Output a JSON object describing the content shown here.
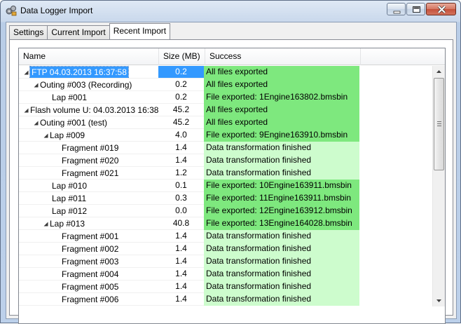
{
  "window": {
    "title": "Data Logger Import"
  },
  "tabs": [
    {
      "label": "Settings",
      "active": false
    },
    {
      "label": "Current Import",
      "active": false
    },
    {
      "label": "Recent Import",
      "active": true
    }
  ],
  "grid": {
    "columns": {
      "name": "Name",
      "size": "Size (MB)",
      "success": "Success"
    },
    "rows": [
      {
        "level": 0,
        "expanded": true,
        "name": "FTP 04.03.2013 16:37:58",
        "size": "0.2",
        "success": "All files exported",
        "status": "ok",
        "selected": true
      },
      {
        "level": 1,
        "expanded": true,
        "name": "Outing #003 (Recording)",
        "size": "0.2",
        "success": "All files exported",
        "status": "ok"
      },
      {
        "level": 2,
        "expanded": null,
        "name": "Lap #001",
        "size": "0.2",
        "success": "File exported:  1Engine163802.bmsbin",
        "status": "ok"
      },
      {
        "level": 0,
        "expanded": true,
        "name": "Flash volume U: 04.03.2013 16:38...",
        "size": "45.2",
        "success": "All files exported",
        "status": "ok"
      },
      {
        "level": 1,
        "expanded": true,
        "name": "Outing #001 (test)",
        "size": "45.2",
        "success": "All files exported",
        "status": "ok"
      },
      {
        "level": 2,
        "expanded": true,
        "name": "Lap #009",
        "size": "4.0",
        "success": "File exported:  9Engine163910.bmsbin",
        "status": "ok"
      },
      {
        "level": 3,
        "expanded": null,
        "name": "Fragment #019",
        "size": "1.4",
        "success": "Data transformation finished",
        "status": "info"
      },
      {
        "level": 3,
        "expanded": null,
        "name": "Fragment #020",
        "size": "1.4",
        "success": "Data transformation finished",
        "status": "info"
      },
      {
        "level": 3,
        "expanded": null,
        "name": "Fragment #021",
        "size": "1.2",
        "success": "Data transformation finished",
        "status": "info"
      },
      {
        "level": 2,
        "expanded": null,
        "name": "Lap #010",
        "size": "0.1",
        "success": "File exported:  10Engine163911.bmsbin",
        "status": "ok"
      },
      {
        "level": 2,
        "expanded": null,
        "name": "Lap #011",
        "size": "0.3",
        "success": "File exported:  11Engine163911.bmsbin",
        "status": "ok"
      },
      {
        "level": 2,
        "expanded": null,
        "name": "Lap #012",
        "size": "0.0",
        "success": "File exported:  12Engine163912.bmsbin",
        "status": "ok"
      },
      {
        "level": 2,
        "expanded": true,
        "name": "Lap #013",
        "size": "40.8",
        "success": "File exported:  13Engine164028.bmsbin",
        "status": "ok"
      },
      {
        "level": 3,
        "expanded": null,
        "name": "Fragment #001",
        "size": "1.4",
        "success": "Data transformation finished",
        "status": "info"
      },
      {
        "level": 3,
        "expanded": null,
        "name": "Fragment #002",
        "size": "1.4",
        "success": "Data transformation finished",
        "status": "info"
      },
      {
        "level": 3,
        "expanded": null,
        "name": "Fragment #003",
        "size": "1.4",
        "success": "Data transformation finished",
        "status": "info"
      },
      {
        "level": 3,
        "expanded": null,
        "name": "Fragment #004",
        "size": "1.4",
        "success": "Data transformation finished",
        "status": "info"
      },
      {
        "level": 3,
        "expanded": null,
        "name": "Fragment #005",
        "size": "1.4",
        "success": "Data transformation finished",
        "status": "info"
      },
      {
        "level": 3,
        "expanded": null,
        "name": "Fragment #006",
        "size": "1.4",
        "success": "Data transformation finished",
        "status": "info"
      }
    ]
  },
  "colors": {
    "ok": "#7ee87e",
    "info": "#cdfccd",
    "selection": "#3399ff"
  },
  "icons": {
    "app": "data-logger-app-icon",
    "expand": "expanded-triangle-icon"
  }
}
